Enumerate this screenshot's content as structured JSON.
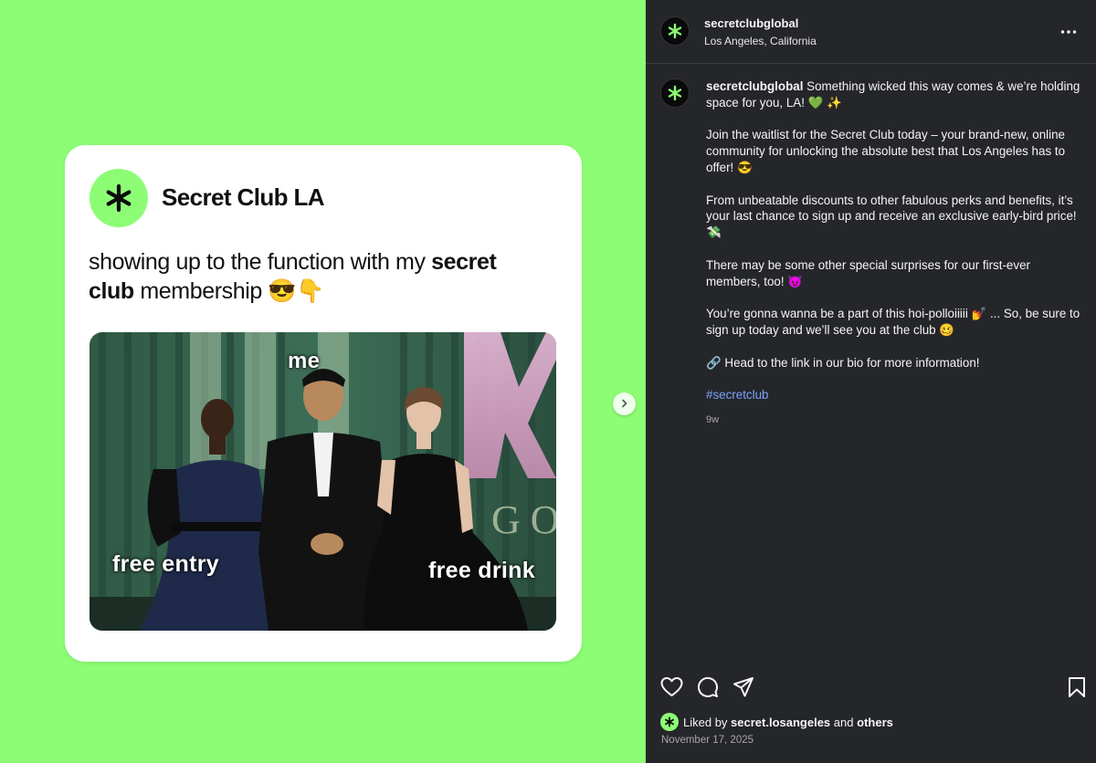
{
  "colors": {
    "brand_green": "#8dfd75",
    "panel_bg": "#25262a",
    "link_blue": "#7aa3ff"
  },
  "media": {
    "card": {
      "logo_icon": "asterisk-icon",
      "name": "Secret Club LA",
      "caption_prefix": "showing up to the function with my ",
      "caption_bold_1": "secret",
      "caption_bold_2": "club",
      "caption_suffix": " membership 😎👇"
    },
    "photo": {
      "label_top": "me",
      "label_left": "free entry",
      "label_right": "free drink"
    },
    "next_icon": "chevron-right-icon"
  },
  "header": {
    "username": "secretclubglobal",
    "location": "Los Angeles, California",
    "more_icon": "more-horizontal-icon"
  },
  "post": {
    "username": "secretclubglobal",
    "p1": " Something wicked this way comes & we’re holding space for you, LA! 💚 ✨",
    "p2": "Join the waitlist for the Secret Club today – your brand-new, online community for unlocking the absolute best that Los Angeles has to offer! 😎",
    "p3": "From unbeatable discounts to other fabulous perks and benefits, it’s your last chance to sign up and receive an exclusive early-bird price! 💸",
    "p4": "There may be some other special surprises for our first-ever members, too! 😈",
    "p5": "You’re gonna wanna be a part of this hoi-polloiiiii 💅 ... So, be sure to sign up today and we’ll see you at the club 🥴",
    "p6": "🔗 Head to the link in our bio for more information!",
    "hashtag": "#secretclub",
    "time_ago": "9w"
  },
  "actions": {
    "like_icon": "heart-icon",
    "comment_icon": "comment-icon",
    "share_icon": "send-icon",
    "save_icon": "bookmark-icon"
  },
  "likes": {
    "prefix": "Liked by ",
    "user": "secret.losangeles",
    "middle": " and ",
    "others": "others"
  },
  "date": "November 17, 2025"
}
